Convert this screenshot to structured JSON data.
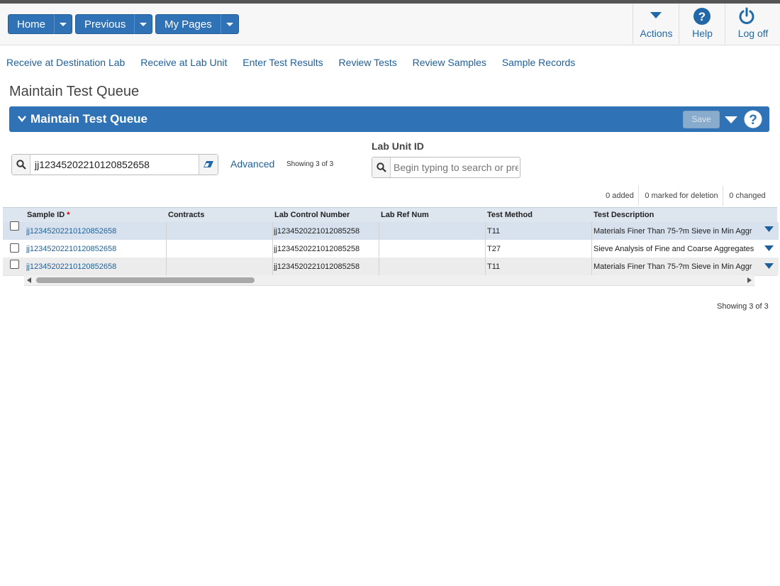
{
  "nav": {
    "home": "Home",
    "previous": "Previous",
    "my_pages": "My Pages"
  },
  "header_actions": {
    "actions": "Actions",
    "help": "Help",
    "logoff": "Log off"
  },
  "links": [
    "Receive at Destination Lab",
    "Receive at Lab Unit",
    "Enter Test Results",
    "Review Tests",
    "Review Samples",
    "Sample Records"
  ],
  "page_title": "Maintain Test Queue",
  "panel": {
    "title": "Maintain Test Queue",
    "save": "Save"
  },
  "search": {
    "value": "jj12345202210120852658",
    "advanced": "Advanced",
    "showing": "Showing 3 of 3"
  },
  "lab_unit": {
    "label": "Lab Unit ID",
    "placeholder": "Begin typing to search or press Enter"
  },
  "counts": {
    "added": "0 added",
    "deleted": "0 marked for deletion",
    "changed": "0 changed"
  },
  "table": {
    "columns": [
      "Sample ID",
      "Contracts",
      "Lab Control Number",
      "Lab Ref Num",
      "Test Method",
      "Test Description"
    ],
    "required_mark": "*",
    "rows": [
      {
        "sample_id": "jj12345202210120852658",
        "contracts": "",
        "lab_control": "jj1234520221012085258",
        "lab_ref": "",
        "test_method": "T11",
        "test_desc": "Materials Finer Than 75-?m Sieve in Min Aggr"
      },
      {
        "sample_id": "jj12345202210120852658",
        "contracts": "",
        "lab_control": "jj1234520221012085258",
        "lab_ref": "",
        "test_method": "T27",
        "test_desc": "Sieve Analysis of Fine and Coarse Aggregates"
      },
      {
        "sample_id": "jj12345202210120852658",
        "contracts": "",
        "lab_control": "jj1234520221012085258",
        "lab_ref": "",
        "test_method": "T11",
        "test_desc": "Materials Finer Than 75-?m Sieve in Min Aggr"
      }
    ]
  },
  "footer": {
    "showing": "Showing 3 of 3"
  },
  "colors": {
    "primary": "#2f72b5",
    "link": "#1f5f99",
    "required": "#cc0000"
  }
}
